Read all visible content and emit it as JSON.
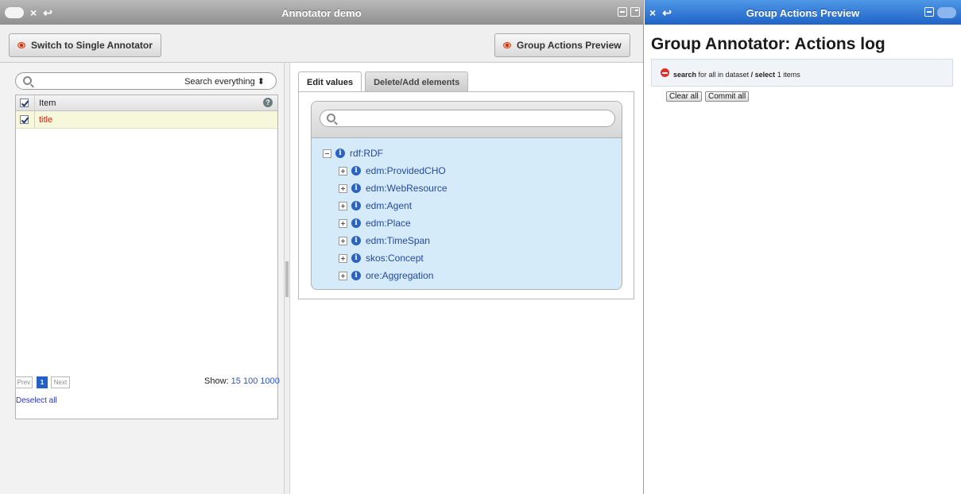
{
  "left_window": {
    "title": "Annotator demo",
    "controls": {
      "close": "×",
      "back": "↩"
    },
    "toolbar": {
      "switch_button": "Switch to Single Annotator",
      "preview_button": "Group Actions Preview"
    },
    "search": {
      "mode": "Search everything ⬍"
    },
    "grid": {
      "header": "Item",
      "rows": [
        {
          "label": "title"
        }
      ]
    },
    "pager": {
      "prev": "Prev",
      "current": "1",
      "next": "Next",
      "show_label": "Show:",
      "sizes": [
        "15",
        "100",
        "1000"
      ]
    },
    "deselect": "Deselect all",
    "tabs": [
      "Edit values",
      "Delete/Add elements"
    ],
    "tree": {
      "root": "rdf:RDF",
      "children": [
        "edm:ProvidedCHO",
        "edm:WebResource",
        "edm:Agent",
        "edm:Place",
        "edm:TimeSpan",
        "skos:Concept",
        "ore:Aggregation"
      ]
    }
  },
  "right_window": {
    "title": "Group Actions Preview",
    "controls": {
      "close": "×",
      "back": "↩"
    },
    "heading": "Group Annotator: Actions log",
    "log": {
      "action1": "search",
      "mid": "for all in dataset",
      "sep": "/",
      "action2": "select",
      "tail": "1 items"
    },
    "clear_button": "Clear all",
    "commit_button": "Commit all"
  },
  "colors": {
    "accent_blue": "#1f63c5",
    "selected_row": "#f7f8db",
    "tree_bg": "#d6ebfa",
    "error_red": "#d81d0c"
  }
}
